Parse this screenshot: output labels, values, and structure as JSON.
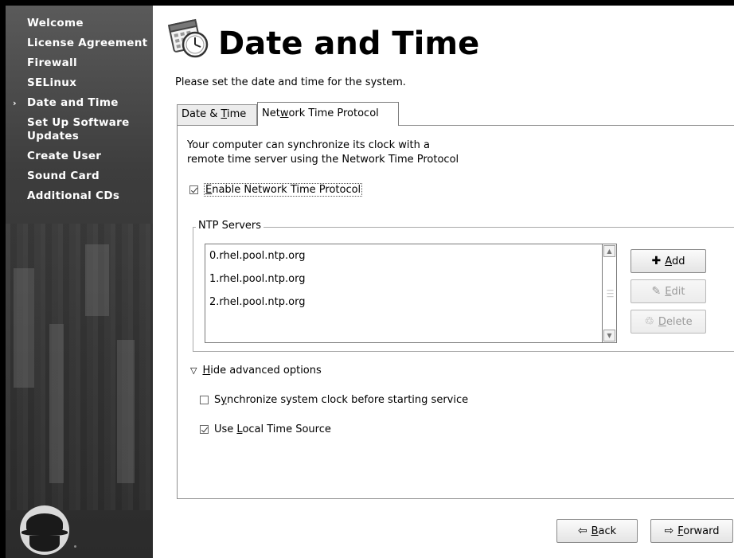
{
  "sidebar": {
    "items": [
      {
        "label": "Welcome",
        "current": false
      },
      {
        "label": "License Agreement",
        "current": false
      },
      {
        "label": "Firewall",
        "current": false
      },
      {
        "label": "SELinux",
        "current": false
      },
      {
        "label": "Date and Time",
        "current": true
      },
      {
        "label": "Set Up Software Updates",
        "current": false
      },
      {
        "label": "Create User",
        "current": false
      },
      {
        "label": "Sound Card",
        "current": false
      },
      {
        "label": "Additional CDs",
        "current": false
      }
    ],
    "current_marker": "›"
  },
  "header": {
    "title": "Date and Time",
    "subtitle": "Please set the date and time for the system."
  },
  "tabs": {
    "date_time": {
      "pre": "Date & ",
      "mn": "T",
      "post": "ime"
    },
    "ntp": {
      "pre": "Net",
      "mn": "w",
      "post": "ork Time Protocol"
    },
    "active": "ntp"
  },
  "ntp": {
    "description_line1": "Your computer can synchronize its clock with a",
    "description_line2": "remote time server using the Network Time Protocol",
    "enable": {
      "mn": "E",
      "rest": "nable Network Time Protocol",
      "checked": true
    },
    "servers_legend": "NTP Servers",
    "servers": [
      "0.rhel.pool.ntp.org",
      "1.rhel.pool.ntp.org",
      "2.rhel.pool.ntp.org"
    ],
    "add": {
      "mn": "A",
      "rest": "dd",
      "enabled": true
    },
    "edit": {
      "mn": "E",
      "rest": "dit",
      "enabled": false
    },
    "delete": {
      "mn": "D",
      "rest": "elete",
      "enabled": false
    },
    "advanced_toggle": {
      "mn": "H",
      "rest": "ide advanced options",
      "expanded": true
    },
    "sync_before": {
      "pre": "S",
      "mn": "y",
      "rest": "nchronize system clock before starting service",
      "checked": false
    },
    "local_source": {
      "pre": "Use ",
      "mn": "L",
      "rest": "ocal Time Source",
      "checked": true
    }
  },
  "footer": {
    "back": {
      "mn": "B",
      "rest": "ack"
    },
    "forward": {
      "mn": "F",
      "rest": "orward"
    }
  },
  "icons": {
    "title": "calendar-clock-icon",
    "add": "plus-icon",
    "edit": "pencil-icon",
    "delete": "trash-icon",
    "back": "arrow-left-icon",
    "forward": "arrow-right-icon"
  }
}
